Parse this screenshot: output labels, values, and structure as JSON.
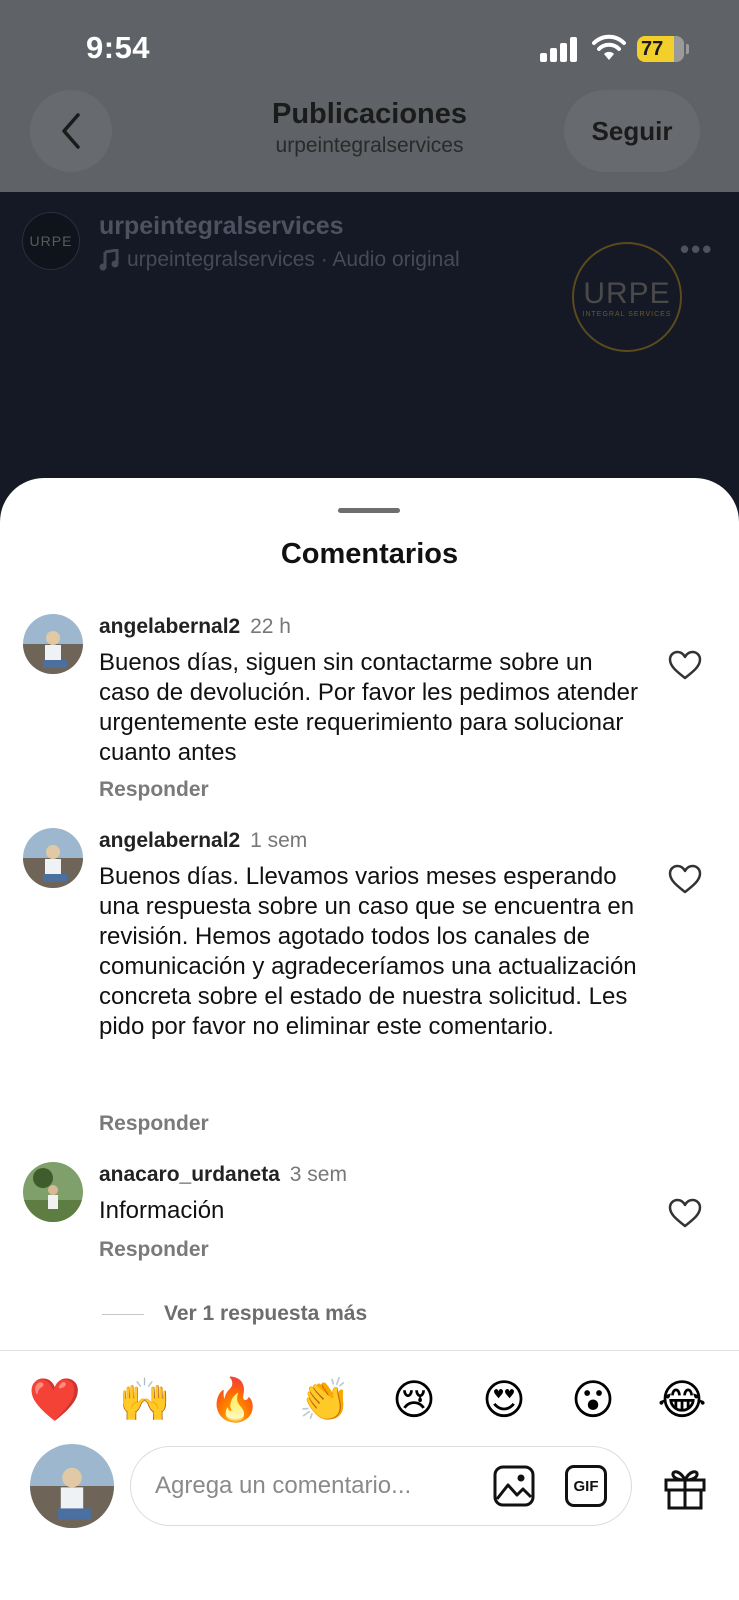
{
  "status": {
    "time": "9:54",
    "battery": "77"
  },
  "header": {
    "title": "Publicaciones",
    "subtitle": "urpeintegralservices",
    "follow_label": "Seguir"
  },
  "post": {
    "username": "urpeintegralservices",
    "audio": "urpeintegralservices · Audio original",
    "logo_text": "URPE",
    "logo_sub": "INTEGRAL SERVICES"
  },
  "sheet": {
    "title": "Comentarios"
  },
  "comments": [
    {
      "user": "angelabernal2",
      "ago": "22 h",
      "text": "Buenos días, siguen sin contactarme sobre un caso de devolución. Por favor les pedimos atender urgentemente este requerimiento para solucionar cuanto antes",
      "reply_label": "Responder"
    },
    {
      "user": "angelabernal2",
      "ago": "1 sem",
      "text": "Buenos días. Llevamos varios meses esperando una respuesta sobre un caso que se encuentra en revisión. Hemos agotado todos los canales de comunicación y agradeceríamos una actualización concreta sobre el estado de nuestra solicitud. Les pido por favor no eliminar este comentario.",
      "reply_label": "Responder"
    },
    {
      "user": "anacaro_urdaneta",
      "ago": "3 sem",
      "text": "Información",
      "reply_label": "Responder",
      "more_replies": "Ver 1 respuesta más"
    }
  ],
  "emojis": [
    "❤️",
    "🙌",
    "🔥",
    "👏",
    "😢",
    "😍",
    "😮",
    "😂"
  ],
  "composer": {
    "placeholder": "Agrega un comentario...",
    "gif_label": "GIF"
  }
}
